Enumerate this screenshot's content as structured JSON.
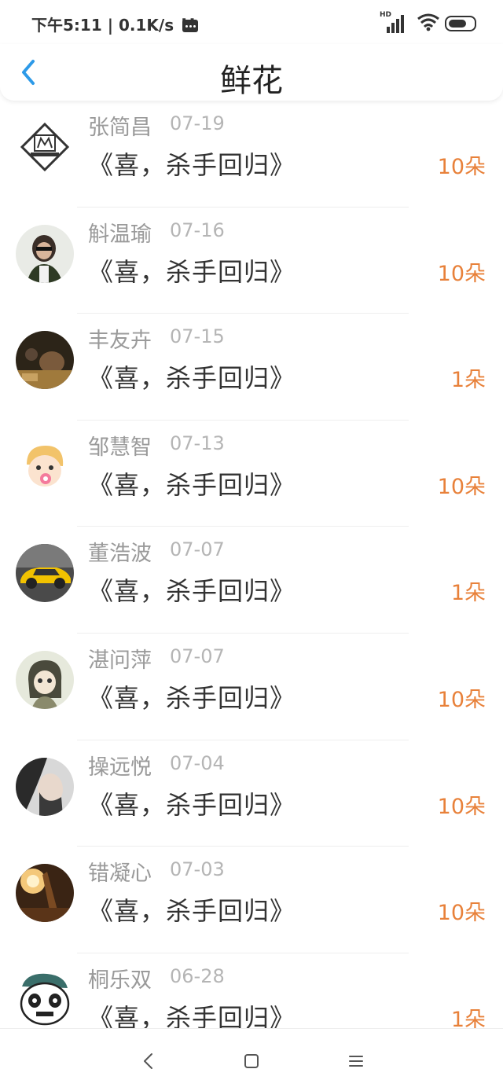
{
  "status_bar": {
    "time_speed": "下午5:11 | 0.1K/s",
    "dots": "··",
    "network_label": "HD"
  },
  "header": {
    "title": "鲜花",
    "back_icon": "chevron-left-icon",
    "accent_color": "#2d9ae8"
  },
  "list": {
    "items": [
      {
        "name": "张简昌",
        "date": "07-19",
        "gift": "《喜，杀手回归》",
        "count": "10朵"
      },
      {
        "name": "斛温瑜",
        "date": "07-16",
        "gift": "《喜，杀手回归》",
        "count": "10朵"
      },
      {
        "name": "丰友卉",
        "date": "07-15",
        "gift": "《喜，杀手回归》",
        "count": "1朵"
      },
      {
        "name": "邹慧智",
        "date": "07-13",
        "gift": "《喜，杀手回归》",
        "count": "10朵"
      },
      {
        "name": "董浩波",
        "date": "07-07",
        "gift": "《喜，杀手回归》",
        "count": "1朵"
      },
      {
        "name": "湛问萍",
        "date": "07-07",
        "gift": "《喜，杀手回归》",
        "count": "10朵"
      },
      {
        "name": "操远悦",
        "date": "07-04",
        "gift": "《喜，杀手回归》",
        "count": "10朵"
      },
      {
        "name": "错凝心",
        "date": "07-03",
        "gift": "《喜，杀手回归》",
        "count": "10朵"
      },
      {
        "name": "桐乐双",
        "date": "06-28",
        "gift": "《喜，杀手回归》",
        "count": "1朵"
      }
    ],
    "count_color": "#e8813a"
  },
  "nav_bar": {
    "back_icon": "nav-back-icon",
    "home_icon": "nav-home-icon",
    "menu_icon": "nav-menu-icon"
  }
}
